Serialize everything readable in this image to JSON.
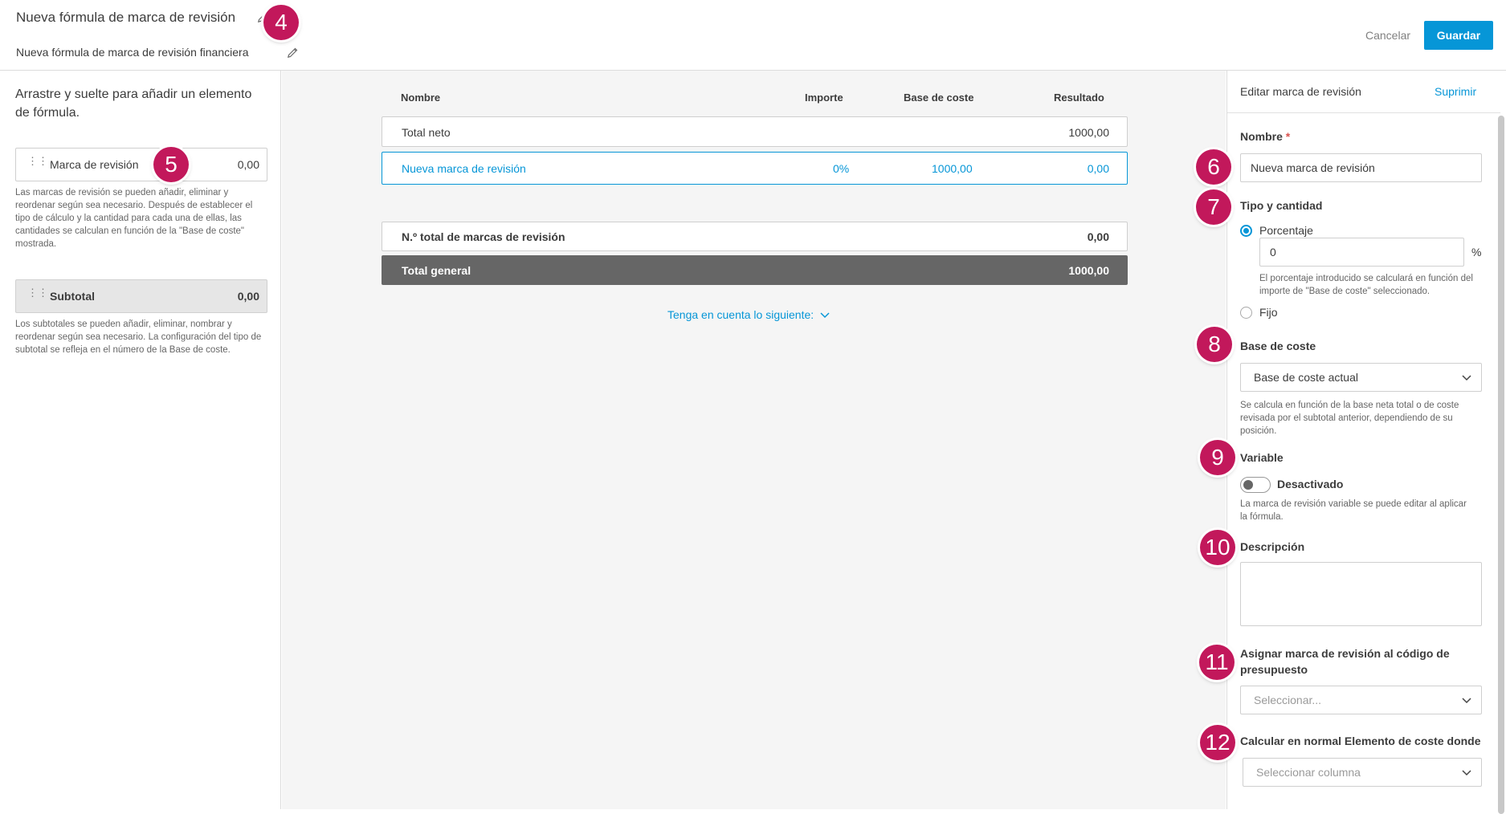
{
  "header": {
    "title": "Nueva fórmula de marca de revisión",
    "subtitle": "Nueva fórmula de marca de revisión financiera",
    "cancel_label": "Cancelar",
    "save_label": "Guardar"
  },
  "callouts": [
    "4",
    "5",
    "6",
    "7",
    "8",
    "9",
    "10",
    "11",
    "12"
  ],
  "left_panel": {
    "title": "Arrastre y suelte para añadir un elemento de fórmula.",
    "items": [
      {
        "label": "Marca de revisión",
        "value": "0,00",
        "help": "Las marcas de revisión se pueden añadir, eliminar y reordenar según sea necesario. Después de establecer el tipo de cálculo y la cantidad para cada una de ellas, las cantidades se calculan en función de la \"Base de coste\" mostrada."
      },
      {
        "label": "Subtotal",
        "value": "0,00",
        "help": "Los subtotales se pueden añadir, eliminar, nombrar y reordenar según sea necesario. La configuración del tipo de subtotal se refleja en el número de la Base de coste."
      }
    ]
  },
  "table": {
    "headers": [
      "Nombre",
      "Importe",
      "Base de coste",
      "Resultado"
    ],
    "rows": [
      {
        "name": "Total neto",
        "amount": "",
        "cost_base": "",
        "result": "1000,00"
      },
      {
        "name": "Nueva marca de revisión",
        "amount": "0%",
        "cost_base": "1000,00",
        "result": "0,00"
      }
    ],
    "summary": [
      {
        "name": "N.º total de marcas de revisión",
        "result": "0,00"
      },
      {
        "name": "Total general",
        "result": "1000,00"
      }
    ],
    "note_link": "Tenga en cuenta lo siguiente:"
  },
  "edit_panel": {
    "heading": "Editar marca de revisión",
    "delete_label": "Suprimir",
    "name_label": "Nombre",
    "required_mark": "*",
    "name_value": "Nueva marca de revisión",
    "type_label": "Tipo y cantidad",
    "percentage_label": "Porcentaje",
    "percentage_value": "0",
    "percent_sign": "%",
    "percentage_help": "El porcentaje introducido se calculará en función del importe de \"Base de coste\" seleccionado.",
    "fixed_label": "Fijo",
    "cost_base_label": "Base de coste",
    "cost_base_value": "Base de coste actual",
    "cost_base_help": "Se calcula en función de la base neta total o de coste revisada por el subtotal anterior, dependiendo de su posición.",
    "variable_label": "Variable",
    "variable_state": "Desactivado",
    "variable_help": "La marca de revisión variable se puede editar al aplicar la fórmula.",
    "description_label": "Descripción",
    "assign_label": "Asignar marca de revisión al código de presupuesto",
    "assign_placeholder": "Seleccionar...",
    "calc_label": "Calcular en normal Elemento de coste donde",
    "calc_placeholder": "Seleccionar columna"
  },
  "colors": {
    "accent": "#0696d7",
    "callout": "#c2185b",
    "grand_total_bg": "#666666"
  }
}
